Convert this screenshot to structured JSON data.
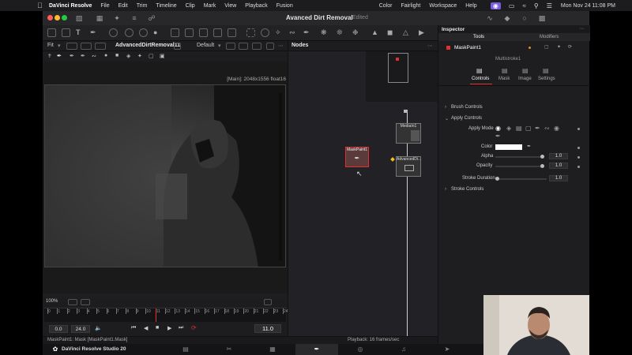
{
  "menubar": {
    "items": [
      "DaVinci Resolve",
      "File",
      "Edit",
      "Trim",
      "Timeline",
      "Clip",
      "Mark",
      "View",
      "Playback",
      "Fusion",
      "Color",
      "Fairlight",
      "Workspace",
      "Help"
    ],
    "datetime": "Mon Nov 24  11:08 PM"
  },
  "window": {
    "title": "Avanced Dirt Removal",
    "status": "Edited"
  },
  "viewer": {
    "zoom": "Fit",
    "node_name": "AdvancedDirtRemoval11",
    "view_mode": "Default",
    "resolution": "[Main]: 2048x1556 float16",
    "scale": "100%"
  },
  "timeline": {
    "ruler": [
      "0",
      "1",
      "2",
      "3",
      "4",
      "5",
      "6",
      "7",
      "8",
      "9",
      "10",
      "11",
      "12",
      "13",
      "14",
      "15",
      "16",
      "17",
      "18",
      "19",
      "20",
      "21",
      "22",
      "23",
      "24"
    ],
    "start": "0.0",
    "end": "24.0",
    "current": "11.0",
    "playhead_frame": 11,
    "total_frames": 24
  },
  "status": {
    "left": "MaskPaint1: Mask    [MaskPaint1.Mask]",
    "playback": "Playback: 16 frames/sec"
  },
  "nodes": {
    "title": "Nodes",
    "items": [
      {
        "label": "MaskPaint1"
      },
      {
        "label": "MediaIn1"
      },
      {
        "label": "AdvancedDi..."
      }
    ]
  },
  "inspector": {
    "title": "Inspector",
    "tabs": [
      "Tools",
      "Modifiers"
    ],
    "tool_name": "MaskPaint1",
    "subtitle": "Multistroke1",
    "subtabs": [
      "Controls",
      "Mask",
      "Image",
      "Settings"
    ],
    "sections": {
      "brush": "Brush Controls",
      "apply": "Apply Controls",
      "stroke": "Stroke Controls"
    },
    "apply_mode_label": "Apply Mode",
    "color_label": "Color",
    "color_value": "#ffffff",
    "alpha_label": "Alpha",
    "alpha_value": "1.0",
    "opacity_label": "Opacity",
    "opacity_value": "1.0",
    "stroke_duration_label": "Stroke Duration",
    "stroke_duration_value": "1.0"
  },
  "pagesbar": {
    "brand": "DaVinci Resolve Studio 20"
  },
  "colors": {
    "accent": "#e03030",
    "active_page": "#ffffff"
  }
}
